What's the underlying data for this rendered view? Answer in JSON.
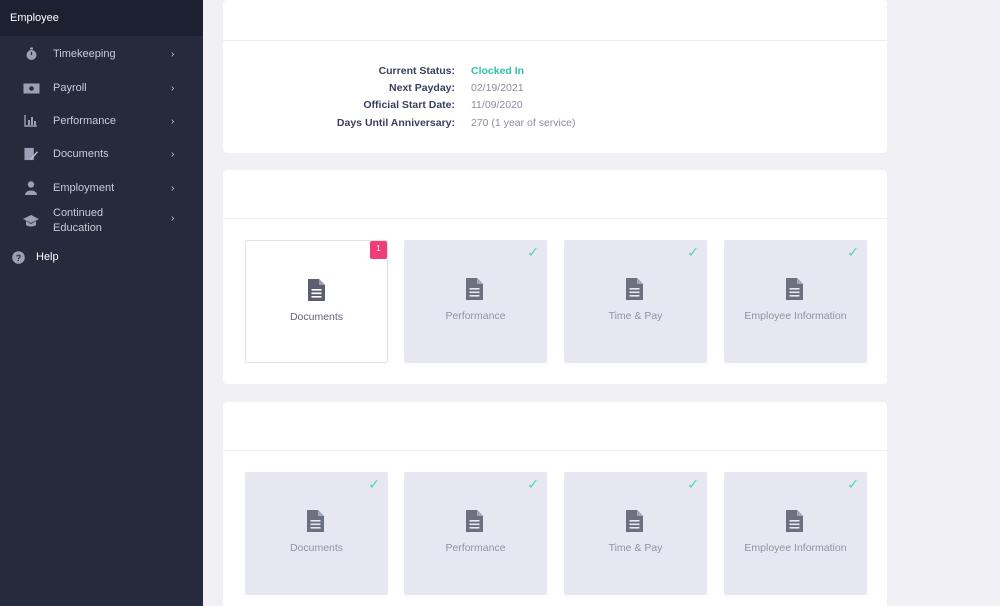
{
  "sidebar": {
    "title": "Employee",
    "items": [
      {
        "label": "Timekeeping",
        "icon": "stopwatch-icon"
      },
      {
        "label": "Payroll",
        "icon": "cash-icon"
      },
      {
        "label": "Performance",
        "icon": "bar-chart-icon"
      },
      {
        "label": "Documents",
        "icon": "document-edit-icon"
      },
      {
        "label": "Employment",
        "icon": "person-icon"
      },
      {
        "label": "Continued Education",
        "icon": "graduation-cap-icon"
      }
    ],
    "help_label": "Help",
    "chevron": "›",
    "help_icon": "question-circle-icon"
  },
  "status": {
    "current_status_label": "Current Status:",
    "current_status_value": "Clocked In",
    "next_payday_label": "Next Payday:",
    "next_payday_value": "02/19/2021",
    "start_date_label": "Official Start Date:",
    "start_date_value": "11/09/2020",
    "days_anniv_label": "Days Until Anniversary:",
    "days_anniv_value": "270 (1 year of service)"
  },
  "section1": {
    "tiles": [
      {
        "label": "Documents",
        "badge": "1"
      },
      {
        "label": "Performance"
      },
      {
        "label": "Time & Pay"
      },
      {
        "label": "Employee Information"
      }
    ]
  },
  "section2": {
    "tiles": [
      {
        "label": "Documents"
      },
      {
        "label": "Performance"
      },
      {
        "label": "Time & Pay"
      },
      {
        "label": "Employee Information"
      }
    ]
  },
  "colors": {
    "sidebar_bg": "#252a3d",
    "accent_green": "#2ec4a6",
    "badge_pink": "#ef3d7a"
  }
}
